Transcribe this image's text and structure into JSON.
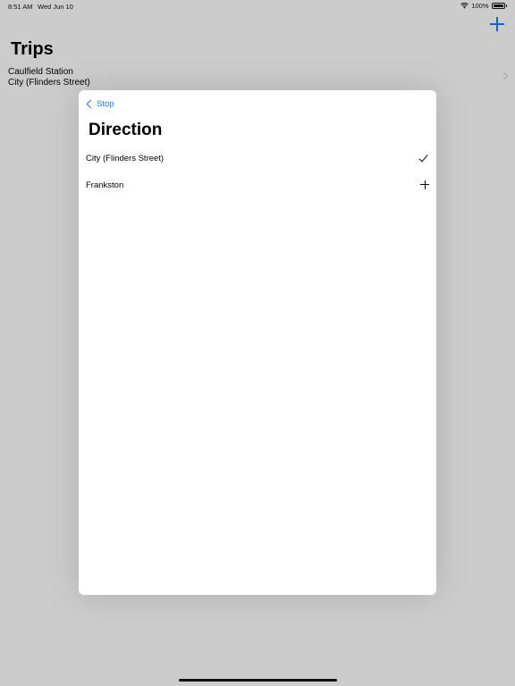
{
  "status_bar": {
    "time": "8:51 AM",
    "date": "Wed Jun 10",
    "battery": "100%",
    "icons": [
      "wifi-icon",
      "battery-icon"
    ]
  },
  "trips_screen": {
    "title": "Trips",
    "add_icon": "plus-icon",
    "trips": [
      {
        "line1": "Caulfield Station",
        "line2": "City (Flinders Street)"
      }
    ]
  },
  "direction_sheet": {
    "back_label": "Stop",
    "title": "Direction",
    "rows": [
      {
        "label": "City (Flinders Street)",
        "accessory": "checkmark-icon"
      },
      {
        "label": "Frankston",
        "accessory": "plus-icon"
      }
    ]
  },
  "colors": {
    "accent": "#1a7cff",
    "dim_overlay": "rgba(0,0,0,0.2)",
    "sheet_background": "#ffffff"
  }
}
